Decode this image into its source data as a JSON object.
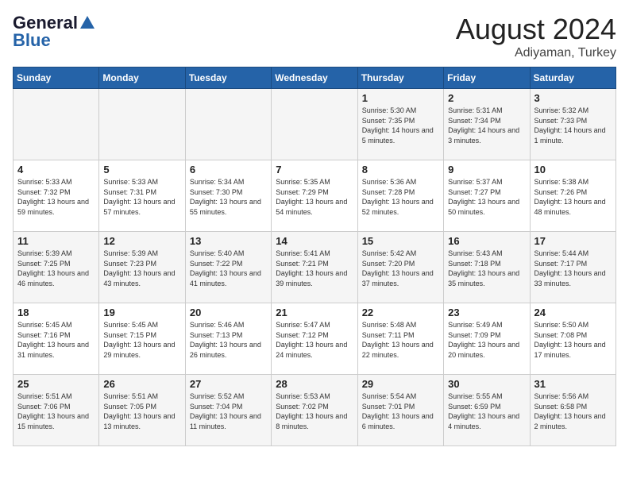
{
  "logo": {
    "general": "General",
    "blue": "Blue"
  },
  "title": {
    "month_year": "August 2024",
    "location": "Adiyaman, Turkey"
  },
  "days_of_week": [
    "Sunday",
    "Monday",
    "Tuesday",
    "Wednesday",
    "Thursday",
    "Friday",
    "Saturday"
  ],
  "weeks": [
    [
      {
        "day": "",
        "sunrise": "",
        "sunset": "",
        "daylight": ""
      },
      {
        "day": "",
        "sunrise": "",
        "sunset": "",
        "daylight": ""
      },
      {
        "day": "",
        "sunrise": "",
        "sunset": "",
        "daylight": ""
      },
      {
        "day": "",
        "sunrise": "",
        "sunset": "",
        "daylight": ""
      },
      {
        "day": "1",
        "sunrise": "Sunrise: 5:30 AM",
        "sunset": "Sunset: 7:35 PM",
        "daylight": "Daylight: 14 hours and 5 minutes."
      },
      {
        "day": "2",
        "sunrise": "Sunrise: 5:31 AM",
        "sunset": "Sunset: 7:34 PM",
        "daylight": "Daylight: 14 hours and 3 minutes."
      },
      {
        "day": "3",
        "sunrise": "Sunrise: 5:32 AM",
        "sunset": "Sunset: 7:33 PM",
        "daylight": "Daylight: 14 hours and 1 minute."
      }
    ],
    [
      {
        "day": "4",
        "sunrise": "Sunrise: 5:33 AM",
        "sunset": "Sunset: 7:32 PM",
        "daylight": "Daylight: 13 hours and 59 minutes."
      },
      {
        "day": "5",
        "sunrise": "Sunrise: 5:33 AM",
        "sunset": "Sunset: 7:31 PM",
        "daylight": "Daylight: 13 hours and 57 minutes."
      },
      {
        "day": "6",
        "sunrise": "Sunrise: 5:34 AM",
        "sunset": "Sunset: 7:30 PM",
        "daylight": "Daylight: 13 hours and 55 minutes."
      },
      {
        "day": "7",
        "sunrise": "Sunrise: 5:35 AM",
        "sunset": "Sunset: 7:29 PM",
        "daylight": "Daylight: 13 hours and 54 minutes."
      },
      {
        "day": "8",
        "sunrise": "Sunrise: 5:36 AM",
        "sunset": "Sunset: 7:28 PM",
        "daylight": "Daylight: 13 hours and 52 minutes."
      },
      {
        "day": "9",
        "sunrise": "Sunrise: 5:37 AM",
        "sunset": "Sunset: 7:27 PM",
        "daylight": "Daylight: 13 hours and 50 minutes."
      },
      {
        "day": "10",
        "sunrise": "Sunrise: 5:38 AM",
        "sunset": "Sunset: 7:26 PM",
        "daylight": "Daylight: 13 hours and 48 minutes."
      }
    ],
    [
      {
        "day": "11",
        "sunrise": "Sunrise: 5:39 AM",
        "sunset": "Sunset: 7:25 PM",
        "daylight": "Daylight: 13 hours and 46 minutes."
      },
      {
        "day": "12",
        "sunrise": "Sunrise: 5:39 AM",
        "sunset": "Sunset: 7:23 PM",
        "daylight": "Daylight: 13 hours and 43 minutes."
      },
      {
        "day": "13",
        "sunrise": "Sunrise: 5:40 AM",
        "sunset": "Sunset: 7:22 PM",
        "daylight": "Daylight: 13 hours and 41 minutes."
      },
      {
        "day": "14",
        "sunrise": "Sunrise: 5:41 AM",
        "sunset": "Sunset: 7:21 PM",
        "daylight": "Daylight: 13 hours and 39 minutes."
      },
      {
        "day": "15",
        "sunrise": "Sunrise: 5:42 AM",
        "sunset": "Sunset: 7:20 PM",
        "daylight": "Daylight: 13 hours and 37 minutes."
      },
      {
        "day": "16",
        "sunrise": "Sunrise: 5:43 AM",
        "sunset": "Sunset: 7:18 PM",
        "daylight": "Daylight: 13 hours and 35 minutes."
      },
      {
        "day": "17",
        "sunrise": "Sunrise: 5:44 AM",
        "sunset": "Sunset: 7:17 PM",
        "daylight": "Daylight: 13 hours and 33 minutes."
      }
    ],
    [
      {
        "day": "18",
        "sunrise": "Sunrise: 5:45 AM",
        "sunset": "Sunset: 7:16 PM",
        "daylight": "Daylight: 13 hours and 31 minutes."
      },
      {
        "day": "19",
        "sunrise": "Sunrise: 5:45 AM",
        "sunset": "Sunset: 7:15 PM",
        "daylight": "Daylight: 13 hours and 29 minutes."
      },
      {
        "day": "20",
        "sunrise": "Sunrise: 5:46 AM",
        "sunset": "Sunset: 7:13 PM",
        "daylight": "Daylight: 13 hours and 26 minutes."
      },
      {
        "day": "21",
        "sunrise": "Sunrise: 5:47 AM",
        "sunset": "Sunset: 7:12 PM",
        "daylight": "Daylight: 13 hours and 24 minutes."
      },
      {
        "day": "22",
        "sunrise": "Sunrise: 5:48 AM",
        "sunset": "Sunset: 7:11 PM",
        "daylight": "Daylight: 13 hours and 22 minutes."
      },
      {
        "day": "23",
        "sunrise": "Sunrise: 5:49 AM",
        "sunset": "Sunset: 7:09 PM",
        "daylight": "Daylight: 13 hours and 20 minutes."
      },
      {
        "day": "24",
        "sunrise": "Sunrise: 5:50 AM",
        "sunset": "Sunset: 7:08 PM",
        "daylight": "Daylight: 13 hours and 17 minutes."
      }
    ],
    [
      {
        "day": "25",
        "sunrise": "Sunrise: 5:51 AM",
        "sunset": "Sunset: 7:06 PM",
        "daylight": "Daylight: 13 hours and 15 minutes."
      },
      {
        "day": "26",
        "sunrise": "Sunrise: 5:51 AM",
        "sunset": "Sunset: 7:05 PM",
        "daylight": "Daylight: 13 hours and 13 minutes."
      },
      {
        "day": "27",
        "sunrise": "Sunrise: 5:52 AM",
        "sunset": "Sunset: 7:04 PM",
        "daylight": "Daylight: 13 hours and 11 minutes."
      },
      {
        "day": "28",
        "sunrise": "Sunrise: 5:53 AM",
        "sunset": "Sunset: 7:02 PM",
        "daylight": "Daylight: 13 hours and 8 minutes."
      },
      {
        "day": "29",
        "sunrise": "Sunrise: 5:54 AM",
        "sunset": "Sunset: 7:01 PM",
        "daylight": "Daylight: 13 hours and 6 minutes."
      },
      {
        "day": "30",
        "sunrise": "Sunrise: 5:55 AM",
        "sunset": "Sunset: 6:59 PM",
        "daylight": "Daylight: 13 hours and 4 minutes."
      },
      {
        "day": "31",
        "sunrise": "Sunrise: 5:56 AM",
        "sunset": "Sunset: 6:58 PM",
        "daylight": "Daylight: 13 hours and 2 minutes."
      }
    ]
  ]
}
